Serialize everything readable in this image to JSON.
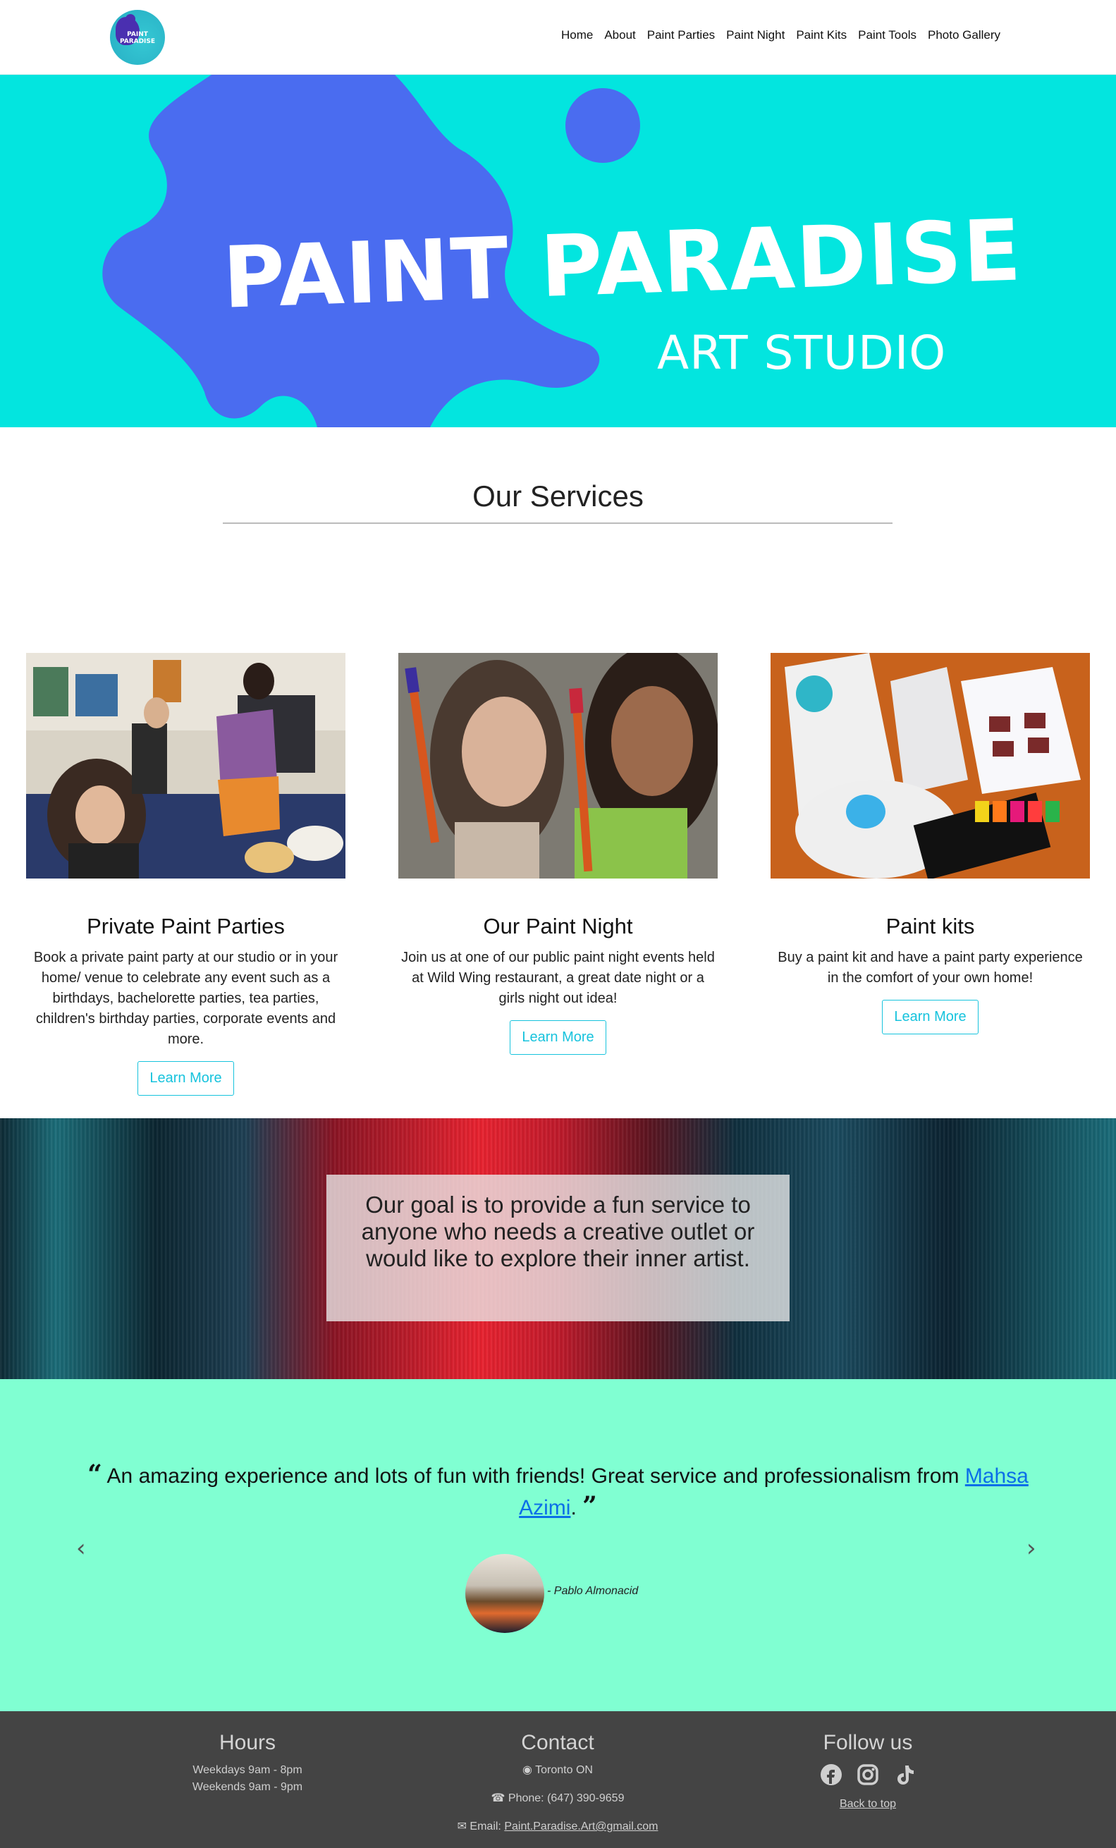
{
  "nav": {
    "logo_text": "PAINT PARADISE",
    "items": [
      {
        "label": "Home"
      },
      {
        "label": "About"
      },
      {
        "label": "Paint Parties"
      },
      {
        "label": "Paint Night"
      },
      {
        "label": "Paint Kits"
      },
      {
        "label": "Paint Tools"
      },
      {
        "label": "Photo Gallery"
      }
    ]
  },
  "hero": {
    "title": "PAINT PARADISE",
    "subtitle": "ART STUDIO",
    "colors": {
      "background": "#03e5df",
      "splash": "#4a6cf0"
    }
  },
  "services": {
    "title": "Our Services",
    "cards": [
      {
        "title": "Private Paint Parties",
        "text": "Book a private paint party at our studio or in your home/ venue to celebrate any event such as a birthdays, bachelorette parties, tea parties, children's birthday parties, corporate events and more.",
        "button": "Learn More"
      },
      {
        "title": "Our Paint Night",
        "text": "Join us at one of our public paint night events held at Wild Wing restaurant, a great date night or a girls night out idea!",
        "button": "Learn More"
      },
      {
        "title": "Paint kits",
        "text": "Buy a paint kit and have a paint party experience in the comfort of your own home!",
        "button": "Learn More"
      }
    ]
  },
  "goal": {
    "text": "Our goal is to provide a fun service to anyone who needs a creative outlet or would like to explore their inner artist."
  },
  "testimonial": {
    "quote_before": "An amazing experience and lots of fun with friends! Great service and professionalism from",
    "link_text": "Mahsa Azimi",
    "quote_after": ".",
    "author": "- Pablo Almonacid",
    "prev_icon": "chevron-left-icon",
    "next_icon": "chevron-right-icon",
    "background": "#80ffd2"
  },
  "footer": {
    "hours": {
      "title": "Hours",
      "weekdays": "Weekdays 9am - 8pm",
      "weekends": "Weekends 9am - 9pm"
    },
    "contact": {
      "title": "Contact",
      "location": "Toronto ON",
      "phone": "Phone: (647) 390-9659",
      "email_label": "Email:",
      "email": "Paint.Paradise.Art@gmail.com"
    },
    "follow": {
      "title": "Follow us",
      "icons": [
        "facebook-icon",
        "instagram-icon",
        "tiktok-icon"
      ],
      "back_to_top": "Back to top"
    },
    "background": "#444444"
  }
}
